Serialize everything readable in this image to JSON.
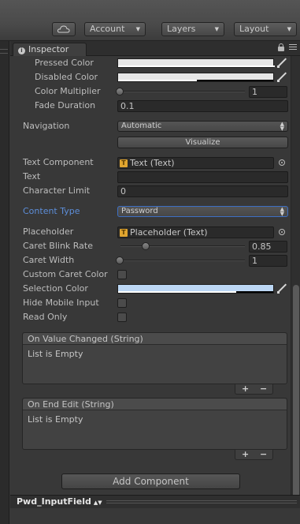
{
  "toolbar": {
    "cloud_icon": "cloud-icon",
    "account_label": "Account",
    "layers_label": "Layers",
    "layout_label": "Layout"
  },
  "inspector": {
    "tab_label": "Inspector",
    "tab_icon": "info-icon"
  },
  "properties": {
    "pressed_color": {
      "label": "Pressed Color",
      "color": "#e6e6e6",
      "alpha": 1.0
    },
    "disabled_color": {
      "label": "Disabled Color",
      "color": "#e6e6e6",
      "alpha": 0.5
    },
    "color_multiplier": {
      "label": "Color Multiplier",
      "value": "1",
      "slider_fraction": 0.0
    },
    "fade_duration": {
      "label": "Fade Duration",
      "value": "0.1"
    },
    "navigation": {
      "label": "Navigation",
      "value": "Automatic"
    },
    "visualize_label": "Visualize",
    "text_component": {
      "label": "Text Component",
      "value": "Text (Text)"
    },
    "text": {
      "label": "Text",
      "value": ""
    },
    "character_limit": {
      "label": "Character Limit",
      "value": "0"
    },
    "content_type": {
      "label": "Content Type",
      "value": "Password"
    },
    "placeholder": {
      "label": "Placeholder",
      "value": "Placeholder (Text)"
    },
    "caret_blink_rate": {
      "label": "Caret Blink Rate",
      "value": "0.85",
      "slider_fraction": 0.21
    },
    "caret_width": {
      "label": "Caret Width",
      "value": "1",
      "slider_fraction": 0.0
    },
    "custom_caret_color": {
      "label": "Custom Caret Color",
      "checked": false
    },
    "selection_color": {
      "label": "Selection Color",
      "color": "#bcd7f4",
      "alpha": 0.75
    },
    "hide_mobile_input": {
      "label": "Hide Mobile Input",
      "checked": false
    },
    "read_only": {
      "label": "Read Only",
      "checked": false
    }
  },
  "events": {
    "on_value_changed": {
      "title": "On Value Changed (String)",
      "empty_text": "List is Empty"
    },
    "on_end_edit": {
      "title": "On End Edit (String)",
      "empty_text": "List is Empty"
    },
    "plus_label": "+",
    "minus_label": "−"
  },
  "add_component_label": "Add Component",
  "bottom_bar": {
    "object_name": "Pwd_InputField"
  },
  "colors": {
    "panel_bg": "#383838",
    "focus_label": "#5d8ed9",
    "object_icon": "#e0a530"
  }
}
